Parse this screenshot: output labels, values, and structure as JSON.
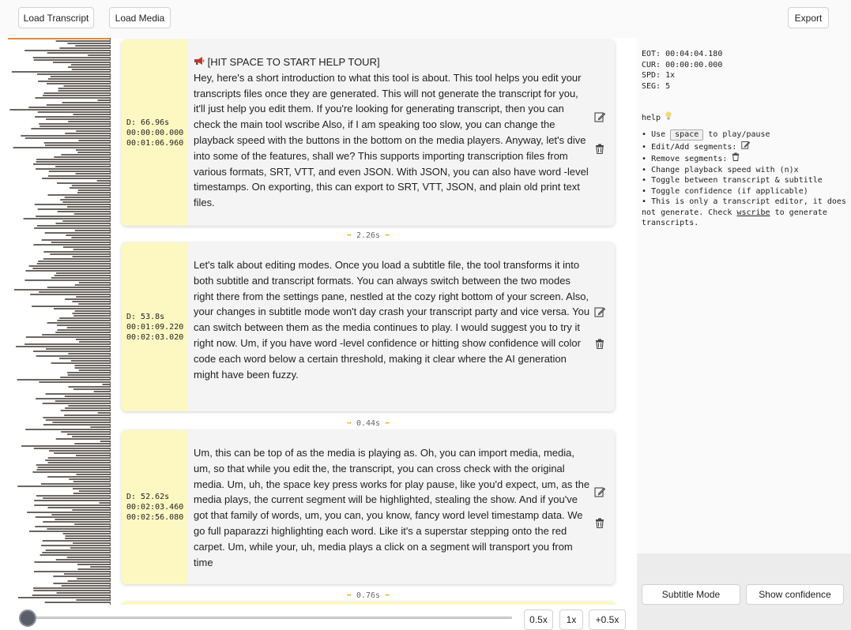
{
  "toolbar": {
    "load_transcript": "Load Transcript",
    "load_media": "Load Media",
    "export": "Export"
  },
  "segments": [
    {
      "duration": "D: 66.96s",
      "start": "00:00:00.000",
      "end": "00:01:06.960",
      "title_icon": "megaphone-icon",
      "title": "[HIT SPACE TO START HELP TOUR]",
      "text": "Hey, here's a short introduction to what this tool is about. This tool helps you edit your transcripts files once they are generated. This will not generate the transcript for you, it'll just help you edit them. If you're looking for generating transcript, then you can check the main tool wscribe Also, if I am speaking too slow, you can change the playback speed with the buttons in the bottom on the media players. Anyway, let's dive into some of the features, shall we? This supports importing transcription files from various formats, SRT, VTT, and even JSON. With JSON, you can also have word -level timestamps. On exporting, this can export to SRT, VTT, JSON, and plain old print text files."
    },
    {
      "duration": "D: 53.8s",
      "start": "00:01:09.220",
      "end": "00:02:03.020",
      "text": "Let's talk about editing modes. Once you load a subtitle file, the tool transforms it into both subtitle and transcript formats. You can always switch between the two modes right there from the settings pane, nestled at the cozy right bottom of your screen. Also, your changes in subtitle mode won't day crash your transcript party and vice versa. You can switch between them as the media continues to play. I would suggest you to try it right now. Um, if you have word -level confidence or hitting show confidence will color code each word below a certain threshold, making it clear where the AI generation might have been fuzzy."
    },
    {
      "duration": "D: 52.62s",
      "start": "00:02:03.460",
      "end": "00:02:56.080",
      "text": "Um, this can be top of as the media is playing as. Oh, you can import media, media, um, so that while you edit the, the transcript, you can cross check with the original media. Um, uh, the space key press works for play pause, like you'd expect, um, as the media plays, the current segment will be highlighted, stealing the show. And if you've got that family of words, um, you can, you know, fancy word level timestamp data. We go full paparazzi highlighting each word. Like it's a superstar stepping onto the red carpet. Um, while your, uh, media plays a click on a segment will transport you from time"
    }
  ],
  "gaps": [
    "2.26s",
    "0.44s",
    "0.76s"
  ],
  "status": {
    "eot": "EOT: 00:04:04.180",
    "cur": "CUR: 00:00:00.000",
    "spd": "SPD: 1x",
    "seg": "SEG: 5"
  },
  "help": {
    "title": "help",
    "bullet": "•",
    "use_prefix": "Use",
    "space_key": "space",
    "use_suffix": "to play/pause",
    "edit_add": "Edit/Add segments:",
    "remove": "Remove segments:",
    "speed": "Change playback speed with (n)x",
    "toggle_mode": "Toggle between transcript & subtitle",
    "toggle_conf": "Toggle confidence (if applicable)",
    "note_prefix": "This is only a transcript editor, it does not generate. Check",
    "note_link": "wscribe",
    "note_suffix": "to generate transcripts."
  },
  "settings": {
    "subtitle_mode": "Subtitle Mode",
    "show_confidence": "Show confidence"
  },
  "player": {
    "progress": 0,
    "speed_half": "0.5x",
    "speed_1x": "1x",
    "speed_plus": "+0.5x"
  },
  "colors": {
    "segment_meta_bg": "#fdf8c2",
    "card_bg": "#f4f4f4",
    "waveform": "#6b6661",
    "waveform_progress": "#e08a3c"
  }
}
